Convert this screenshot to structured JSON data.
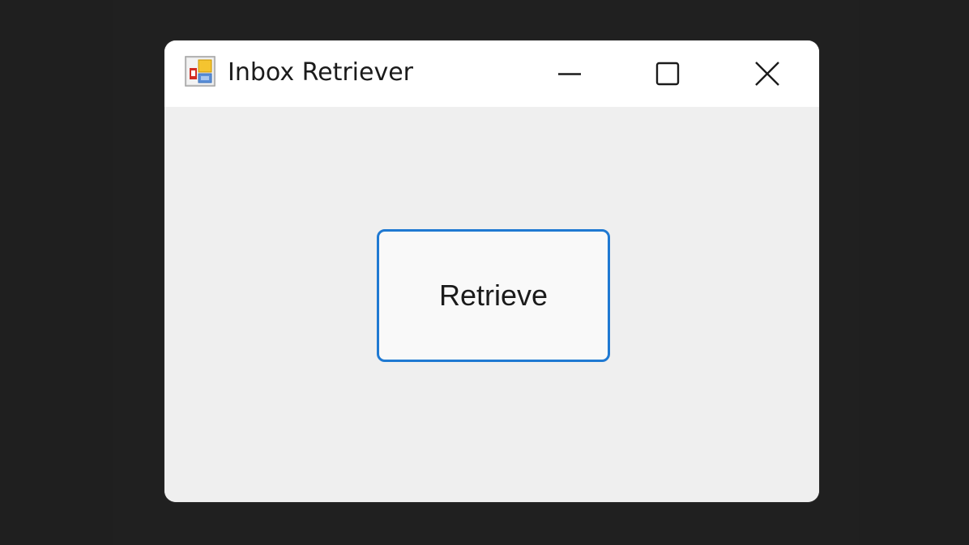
{
  "window": {
    "title": "Inbox Retriever",
    "icon": "windows-forms-app-icon",
    "controls": {
      "minimize_icon": "minimize-icon",
      "maximize_icon": "maximize-icon",
      "close_icon": "close-icon"
    }
  },
  "form": {
    "button_label": "Retrieve"
  },
  "colors": {
    "desktop_background": "#1f1f1f",
    "titlebar_background": "#ffffff",
    "client_background": "#efefef",
    "button_border_accent": "#1f79d2",
    "button_fill": "#f9f9f9"
  }
}
